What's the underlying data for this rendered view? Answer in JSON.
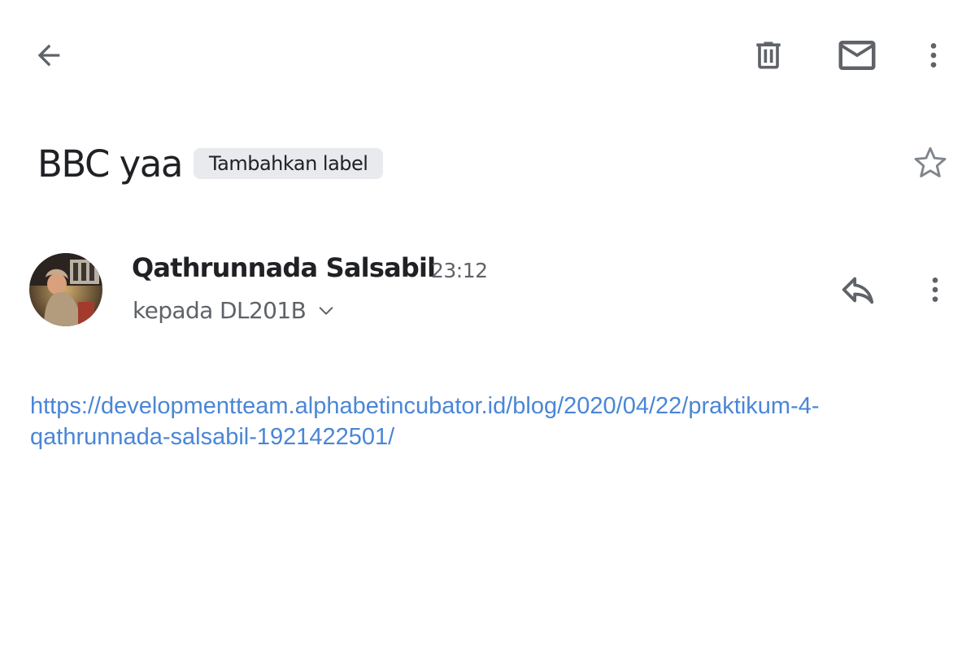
{
  "toolbar": {
    "back_icon": "arrow-back-icon",
    "delete_icon": "trash-icon",
    "mark_unread_icon": "mail-icon",
    "more_icon": "more-vert-icon"
  },
  "message": {
    "subject": "BBC yaa",
    "add_label_chip": "Tambahkan label",
    "star_icon": "star-outline-icon",
    "sender_name": "Qathrunnada Salsabil",
    "time": "23:12",
    "recipient": "kepada DL201B",
    "body_link_line1": "https://developmentteam.alphabetincubator.id/blog/2020/04/22/praktikum-4-",
    "body_link_line2": "qathrunnada-salsabil-1921422501/"
  },
  "colors": {
    "icon_gray": "#5f6368",
    "link_blue": "#4a86d6",
    "chip_bg": "#e8eaed",
    "text_dark": "#202124"
  }
}
